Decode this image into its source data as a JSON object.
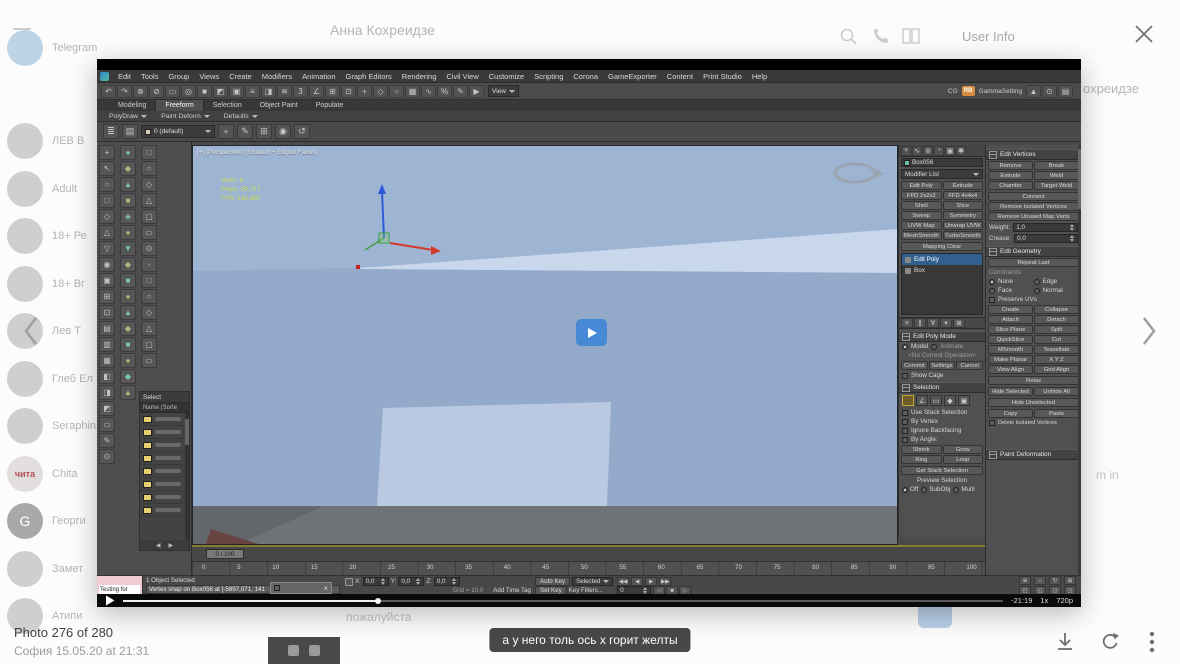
{
  "overlay": {
    "photo_counter": "Photo 276 of 280",
    "photo_meta": "София 15.05.20 at 21:31",
    "caption": "а у него толь ось x горит желты"
  },
  "background": {
    "header_title": "Анна Кохреидзе",
    "title_fragment": "охреидзе",
    "user_info": "User Info",
    "side_fragment": "m in",
    "input_fragment": "пожалуйста",
    "chats": [
      {
        "name": "Telegram",
        "initial": ""
      },
      {
        "name": "ЛЕВ В",
        "initial": ""
      },
      {
        "name": "Adult",
        "initial": ""
      },
      {
        "name": "18+ Ре",
        "initial": ""
      },
      {
        "name": "18+ Вг",
        "initial": ""
      },
      {
        "name": "Лев Т",
        "initial": ""
      },
      {
        "name": "Глеб Ел",
        "initial": ""
      },
      {
        "name": "Seraphin",
        "initial": ""
      },
      {
        "name": "Chita",
        "initial": "чита"
      },
      {
        "name": "Георги",
        "initial": "G"
      },
      {
        "name": "Замет",
        "initial": ""
      },
      {
        "name": "Атипи",
        "initial": ""
      }
    ]
  },
  "player": {
    "remaining": "-21:19",
    "speed": "1x",
    "quality": "720p"
  },
  "max": {
    "menus": [
      "Edit",
      "Tools",
      "Group",
      "Views",
      "Create",
      "Modifiers",
      "Animation",
      "Graph Editors",
      "Rendering",
      "Civil View",
      "Customize",
      "Scripting",
      "Corona",
      "GameExporter",
      "Content",
      "Print Studio",
      "Help"
    ],
    "toolbar_icons": [
      "↶",
      "↷",
      "⊗",
      "⊘",
      "▭",
      "◎",
      "■",
      "◩",
      "▣",
      "≡",
      "◨",
      "≋",
      "3",
      "∠",
      "⊞",
      "⊡",
      "+",
      "◇",
      "○",
      "▦",
      "∿",
      "%",
      "✎",
      "▶"
    ],
    "coord_dropdown": "View",
    "right_cluster": {
      "cg": "CG",
      "rb": "RB",
      "gamma": "GammaSetting",
      "icons": [
        "▲",
        "⊙",
        "▤"
      ]
    },
    "ribbon_tabs": [
      "Modeling",
      "Freeform",
      "Selection",
      "Object Paint",
      "Populate"
    ],
    "ribbon_panels": [
      "PolyDraw",
      "Paint Deform",
      "Defaults"
    ],
    "toolbar2_left": [
      "≣",
      "▤"
    ],
    "paint_dropdown": "0 (default)",
    "toolbar2_right": [
      "+",
      "✎",
      "⊞",
      "◉",
      "↺"
    ],
    "left_icons_a": [
      "+",
      "↖",
      "○",
      "□",
      "◇",
      "△",
      "▽",
      "◉",
      "▣",
      "⊞",
      "⊡",
      "▤",
      "▥",
      "▦",
      "◧",
      "◨",
      "◩",
      "▭",
      "✎",
      "⊙"
    ],
    "left_icons_b": [
      "●",
      "◆",
      "▲",
      "■",
      "◈",
      "●",
      "▼",
      "◆",
      "■",
      "●",
      "▲",
      "◆",
      "■",
      "●",
      "◆",
      "▲"
    ],
    "left_icons_c": [
      "□",
      "○",
      "◇",
      "△",
      "▢",
      "▭",
      "⊙",
      "◦",
      "□",
      "○",
      "◇",
      "△",
      "▢",
      "▭"
    ],
    "scene": {
      "select_title": "Select",
      "name_header": "Name (Sorte",
      "foot_left": "◀",
      "foot_right": "▶"
    },
    "viewport": {
      "label": "[+] [Perspective] [Shaded + Edged Faces]",
      "stats": [
        "Verts: 8",
        "Polys: 38,717",
        "FPS: 142.887"
      ]
    },
    "panel1": {
      "tab_icons": [
        "+",
        "∿",
        "⊚",
        "◔",
        "▣",
        "✱"
      ],
      "object_name": "Box056",
      "modifier_list": "Modifier List",
      "modifier_buttons": [
        "Edit Poly",
        "Extrude",
        "FFD 2x2x2",
        "FFD 4x4x4",
        "Shell",
        "Slice",
        "Sweep",
        "Symmetry",
        "UVW Map",
        "Unwrap UVW",
        "MeshSmooth",
        "TurboSmooth"
      ],
      "modifier_wide": "Mapping Clear",
      "stack_row1": "Edit Poly",
      "stack_row2": "Box",
      "stack_tools": [
        "≡",
        "∥",
        "∀",
        "▾",
        "⊠"
      ],
      "mode": {
        "title": "Edit Poly Mode",
        "model": "Model",
        "animate": "Animate",
        "operation": "<No Current Operation>",
        "buttons": [
          "Commit",
          "Settings",
          "Cancel"
        ],
        "show_cage": "Show Cage"
      },
      "selection": {
        "title": "Selection",
        "subobj_icons": [
          "∵",
          "∠",
          "▭",
          "◆",
          "▣"
        ],
        "checks": [
          "Use Stack Selection",
          "By Vertex",
          "Ignore Backfacing",
          "By Angle:"
        ],
        "sgrl": [
          "Shrink",
          "Grow",
          "Ring",
          "Loop"
        ],
        "get_stack": "Get Stack Selection",
        "preview": "Preview Selection",
        "preview_modes": [
          "Off",
          "SubObj",
          "Multi"
        ]
      }
    },
    "panel2": {
      "edit_vertices": {
        "title": "Edit Vertices",
        "pairs": [
          "Remove",
          "Break",
          "Extrude",
          "Weld",
          "Chamfer",
          "Target Weld"
        ],
        "wides": [
          "Connect",
          "Remove Isolated Vertices",
          "Remove Unused Map Verts"
        ],
        "weight_label": "Weight:",
        "weight_value": "1,0",
        "crease_label": "Crease:",
        "crease_value": "0,0"
      },
      "edit_geometry": {
        "title": "Edit Geometry",
        "repeat_last": "Repeat Last",
        "constraints_label": "Constraints:",
        "constraints": [
          "None",
          "Edge",
          "Face",
          "Normal"
        ],
        "preserve_uvs": "Preserve UVs",
        "pairs": [
          "Create",
          "Collapse",
          "Attach",
          "Detach",
          "Slice Plane",
          "Split",
          "QuickSlice",
          "Cut",
          "MSmooth",
          "Tessellate",
          "Make Planar",
          "X  Y  Z",
          "View Align",
          "Grid Align"
        ],
        "relax": "Relax",
        "hide_pair": [
          "Hide Selected",
          "Unhide All"
        ],
        "hide_unselected": "Hide Unselected",
        "copy_paste": [
          "Copy",
          "Paste"
        ],
        "delete_isolated": "Delete Isolated Vertices"
      },
      "paint_deformation": "Paint Deformation"
    },
    "timeline": {
      "slider": "0 / 100",
      "ticks": [
        "0",
        "5",
        "10",
        "15",
        "20",
        "25",
        "30",
        "35",
        "40",
        "45",
        "50",
        "55",
        "60",
        "65",
        "70",
        "75",
        "80",
        "85",
        "90",
        "95",
        "100"
      ]
    },
    "status": {
      "listener": "Testing for",
      "selected": "1 Object Selected",
      "prompt": "Vertex snap on Box056 at [-5897,071, 141",
      "popup_close": "×",
      "x": "X:",
      "y": "Y:",
      "z": "Z:",
      "coord_values": [
        "0,0",
        "0,0",
        "0,0"
      ],
      "grid": "Grid = 10,0",
      "add_time_tag": "Add Time Tag",
      "auto_key": "Auto Key",
      "set_key": "Set Key",
      "selection_set": "Selected",
      "key_filters": "Key Filters...",
      "frame": "0",
      "play_icons1": [
        "◀◀",
        "◀",
        "▶",
        "▶▶"
      ],
      "play_icons2": [
        "◁",
        "■",
        "▷"
      ],
      "nav_icons": [
        "⊕",
        "⌂",
        "↻",
        "⊞",
        "◰",
        "◱",
        "◲",
        "◳"
      ]
    }
  }
}
